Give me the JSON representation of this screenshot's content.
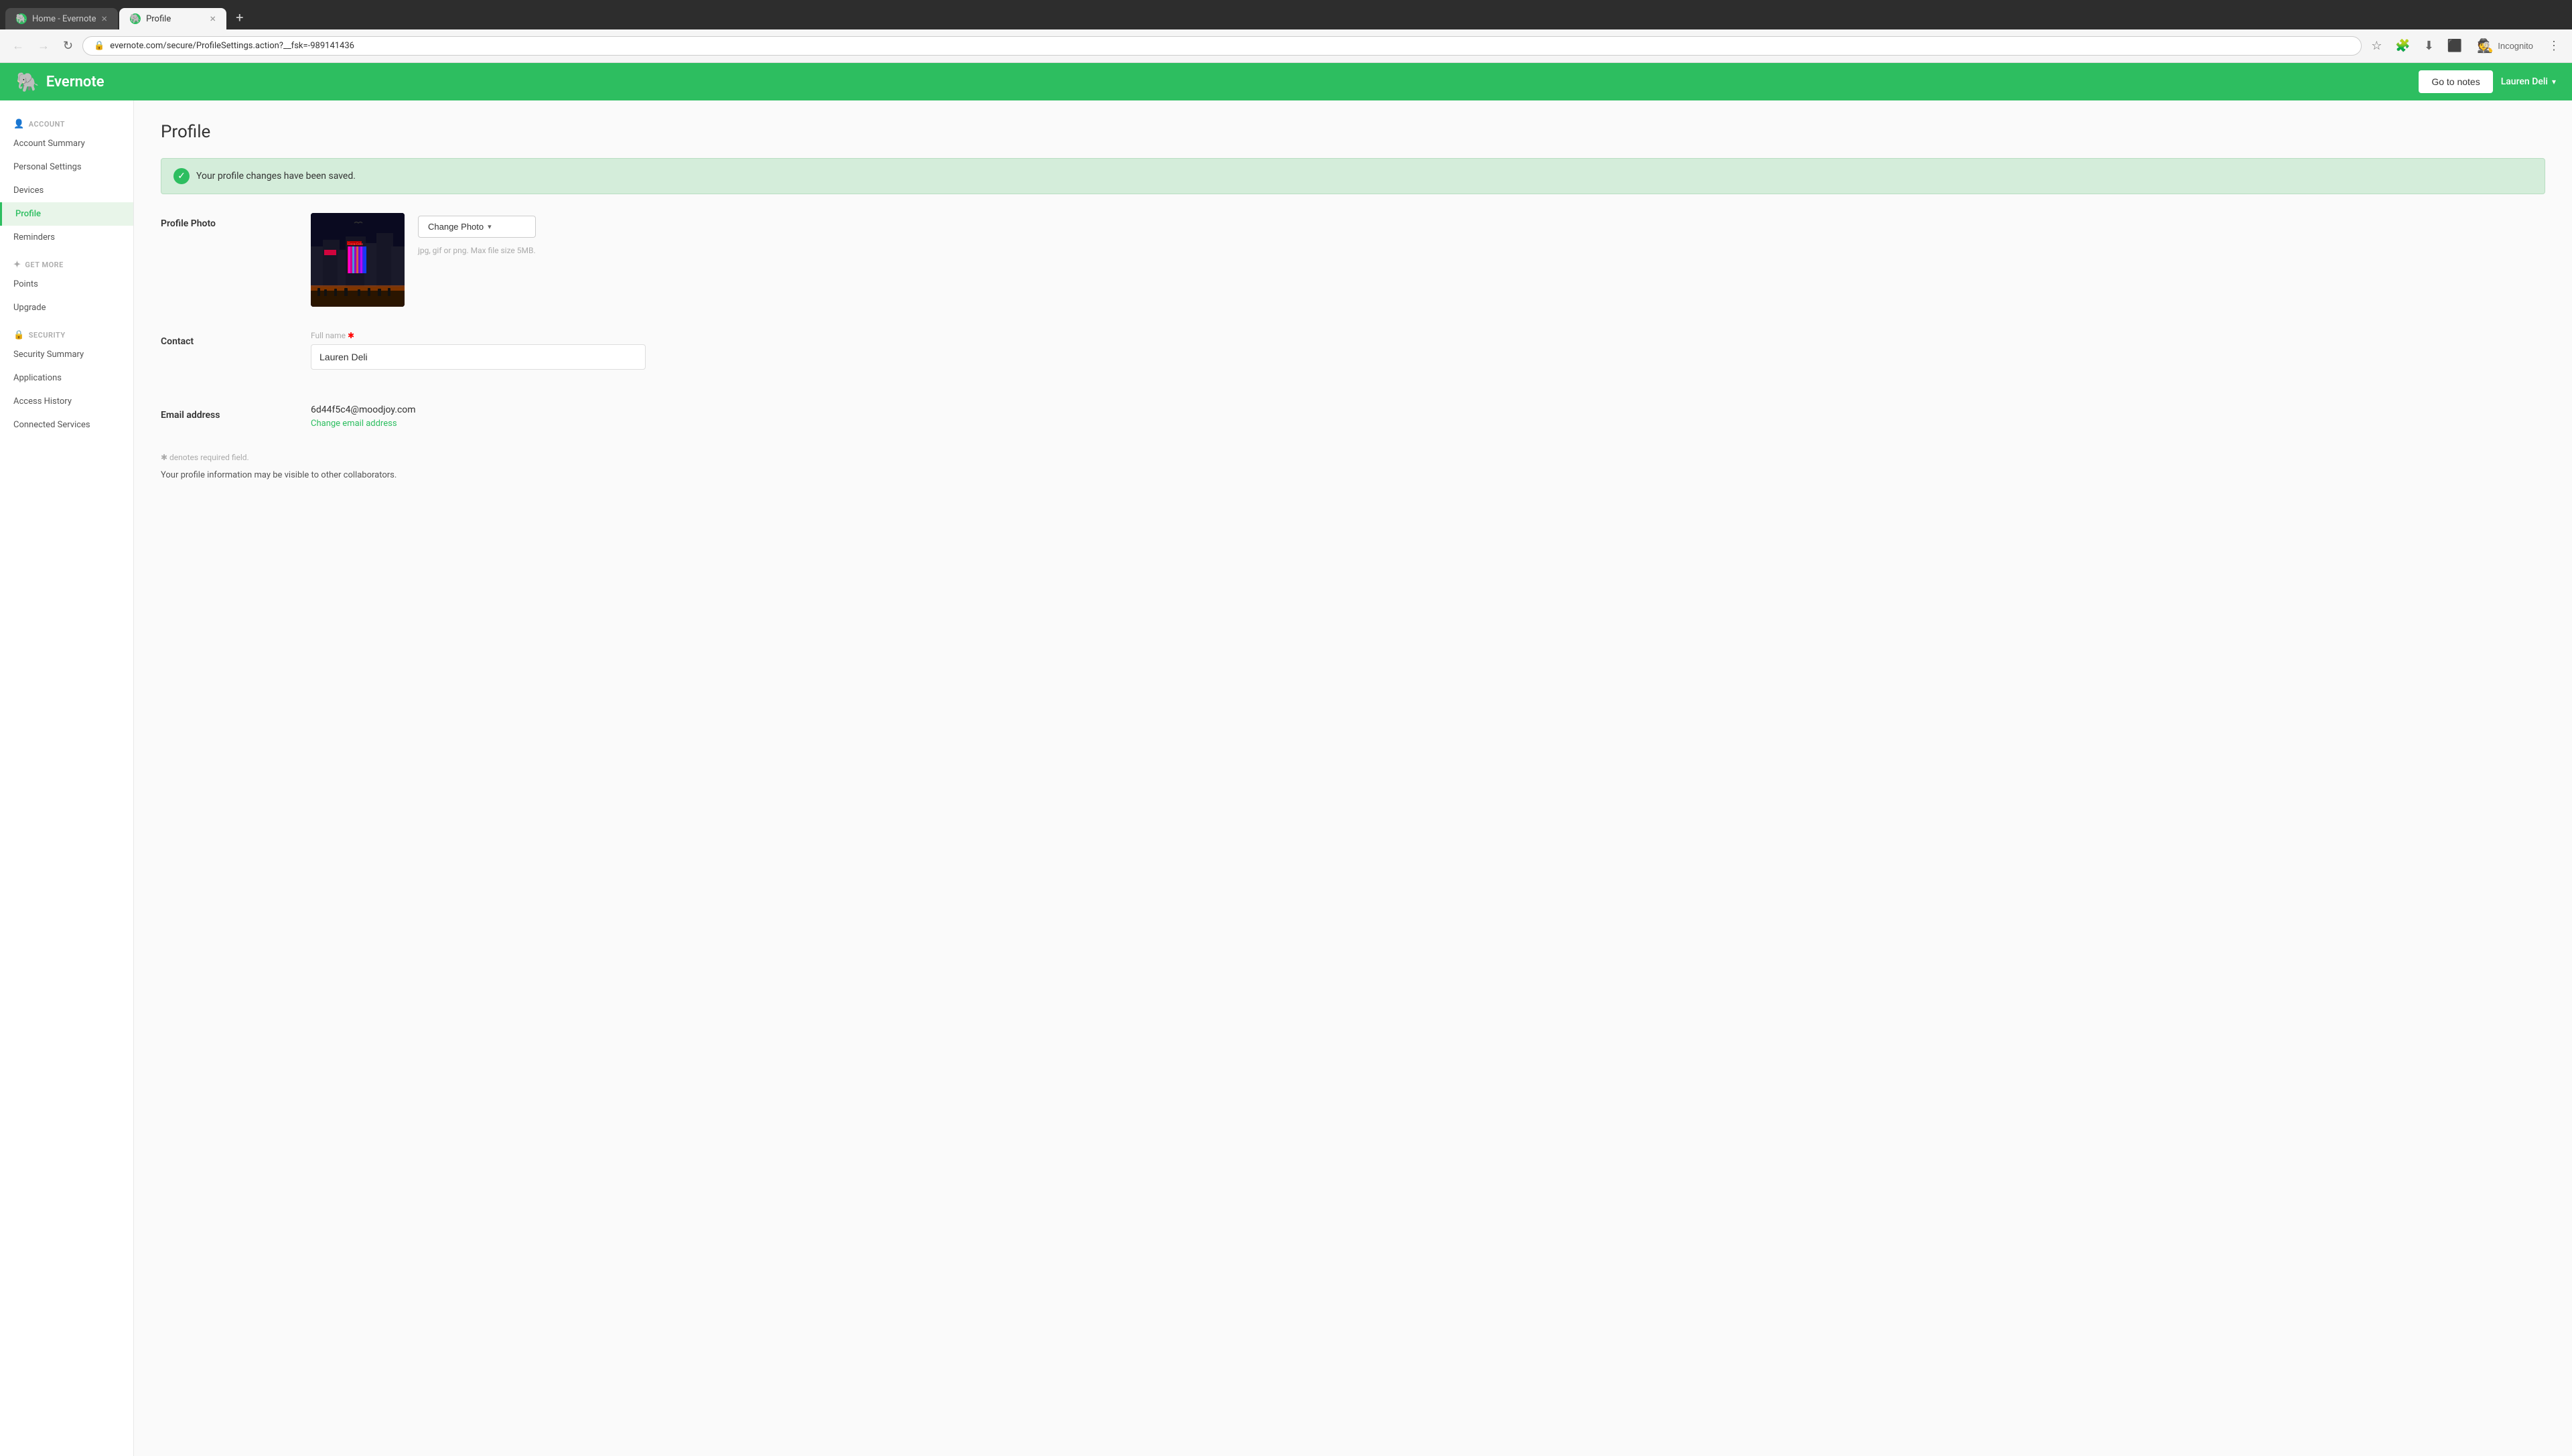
{
  "browser": {
    "tabs": [
      {
        "id": "home",
        "label": "Home - Evernote",
        "active": false,
        "favicon": "🐘"
      },
      {
        "id": "profile",
        "label": "Profile",
        "active": true,
        "favicon": "🐘"
      }
    ],
    "tab_new_label": "+",
    "address_bar": {
      "url": "evernote.com/secure/ProfileSettings.action?__fsk=-989141436",
      "full_url": "evernote.com/secure/ProfileSettings.action?__fsk=-989141436"
    },
    "nav": {
      "back_label": "←",
      "forward_label": "→",
      "refresh_label": "↻"
    },
    "toolbar": {
      "bookmark_icon": "☆",
      "extensions_icon": "🧩",
      "download_icon": "⬇",
      "sidebar_icon": "⬛",
      "incognito_label": "Incognito",
      "incognito_icon": "🕵",
      "menu_icon": "⋮"
    }
  },
  "header": {
    "logo_text": "Evernote",
    "logo_icon": "🐘",
    "go_to_notes_label": "Go to notes",
    "user_name": "Lauren Deli",
    "user_chevron": "▾"
  },
  "sidebar": {
    "account_section": {
      "label": "ACCOUNT",
      "icon": "👤",
      "items": [
        {
          "id": "account-summary",
          "label": "Account Summary",
          "active": false
        },
        {
          "id": "personal-settings",
          "label": "Personal Settings",
          "active": false
        },
        {
          "id": "devices",
          "label": "Devices",
          "active": false
        },
        {
          "id": "profile",
          "label": "Profile",
          "active": true
        },
        {
          "id": "reminders",
          "label": "Reminders",
          "active": false
        }
      ]
    },
    "get_more_section": {
      "label": "GET MORE",
      "icon": "✦",
      "items": [
        {
          "id": "points",
          "label": "Points",
          "active": false
        },
        {
          "id": "upgrade",
          "label": "Upgrade",
          "active": false
        }
      ]
    },
    "security_section": {
      "label": "SECURITY",
      "icon": "🔒",
      "items": [
        {
          "id": "security-summary",
          "label": "Security Summary",
          "active": false
        },
        {
          "id": "applications",
          "label": "Applications",
          "active": false
        },
        {
          "id": "access-history",
          "label": "Access History",
          "active": false
        },
        {
          "id": "connected-services",
          "label": "Connected Services",
          "active": false
        }
      ]
    }
  },
  "main": {
    "page_title": "Profile",
    "success_banner": {
      "text": "Your profile changes have been saved.",
      "icon": "✓"
    },
    "profile_photo_section": {
      "label": "Profile Photo",
      "change_photo_label": "Change Photo",
      "change_photo_chevron": "▾",
      "hint_text": "jpg, gif or png. Max file size 5MB."
    },
    "contact_section": {
      "label": "Contact",
      "full_name_label": "Full name",
      "full_name_required": "✱",
      "full_name_value": "Lauren Deli"
    },
    "email_section": {
      "label": "Email address",
      "email_value": "6d44f5c4@moodjoy.com",
      "change_email_label": "Change email address"
    },
    "footer": {
      "required_note": "✱ denotes required field.",
      "privacy_note": "Your profile information may be visible to other collaborators."
    }
  }
}
